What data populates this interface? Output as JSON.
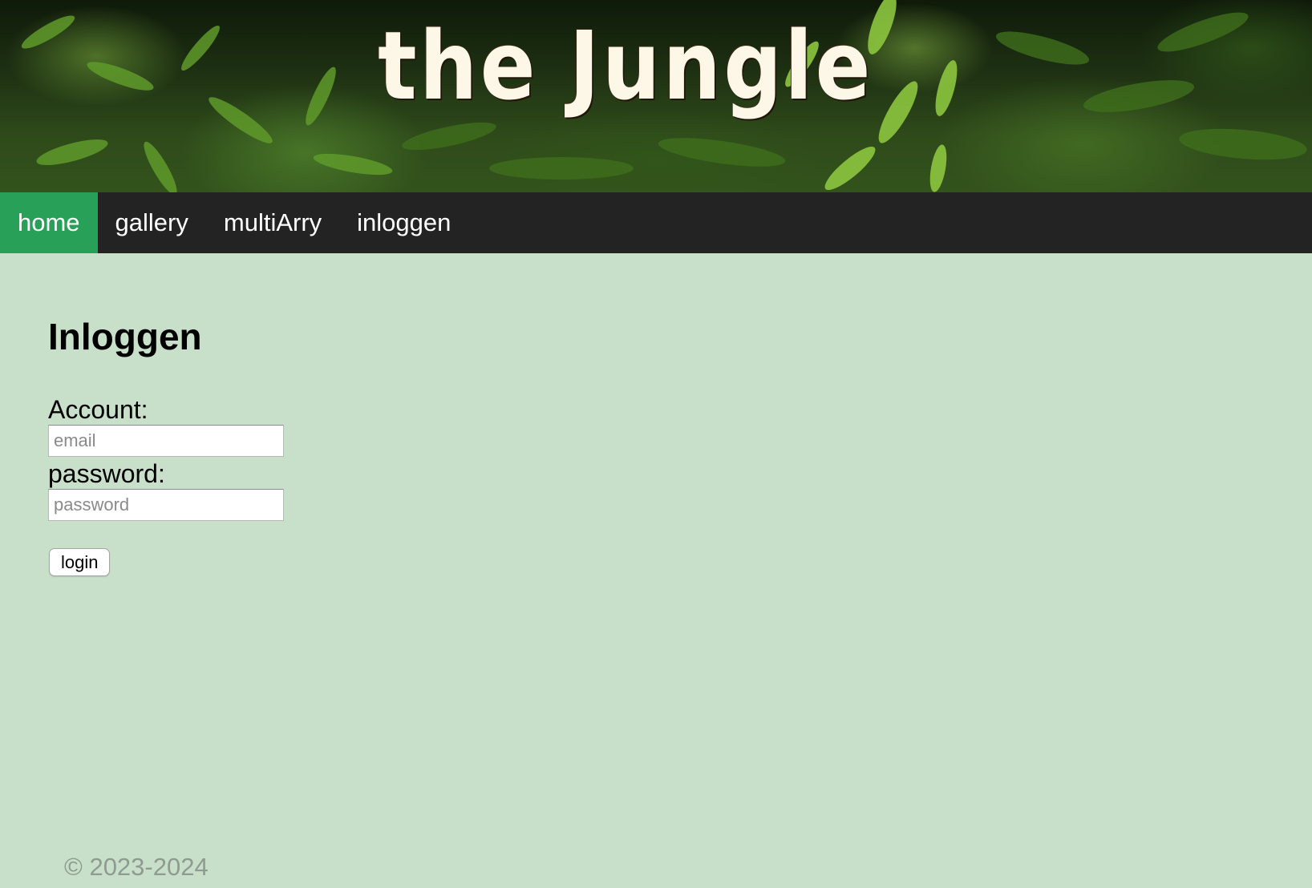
{
  "banner": {
    "title": "the Jungle"
  },
  "nav": {
    "items": [
      {
        "label": "home",
        "active": true
      },
      {
        "label": "gallery",
        "active": false
      },
      {
        "label": "multiArry",
        "active": false
      },
      {
        "label": "inloggen",
        "active": false
      }
    ]
  },
  "login": {
    "heading": "Inloggen",
    "account_label": "Account:",
    "email_placeholder": "email",
    "email_value": "",
    "password_label": "password:",
    "password_placeholder": "password",
    "password_value": "",
    "submit_label": "login"
  },
  "footer": {
    "copyright": "© 2023-2024"
  },
  "colors": {
    "page_background": "#c8e0ca",
    "nav_background": "#232323",
    "nav_active": "#28a057",
    "banner_title": "#fdf7e8",
    "footer_text": "#8f9a90"
  }
}
